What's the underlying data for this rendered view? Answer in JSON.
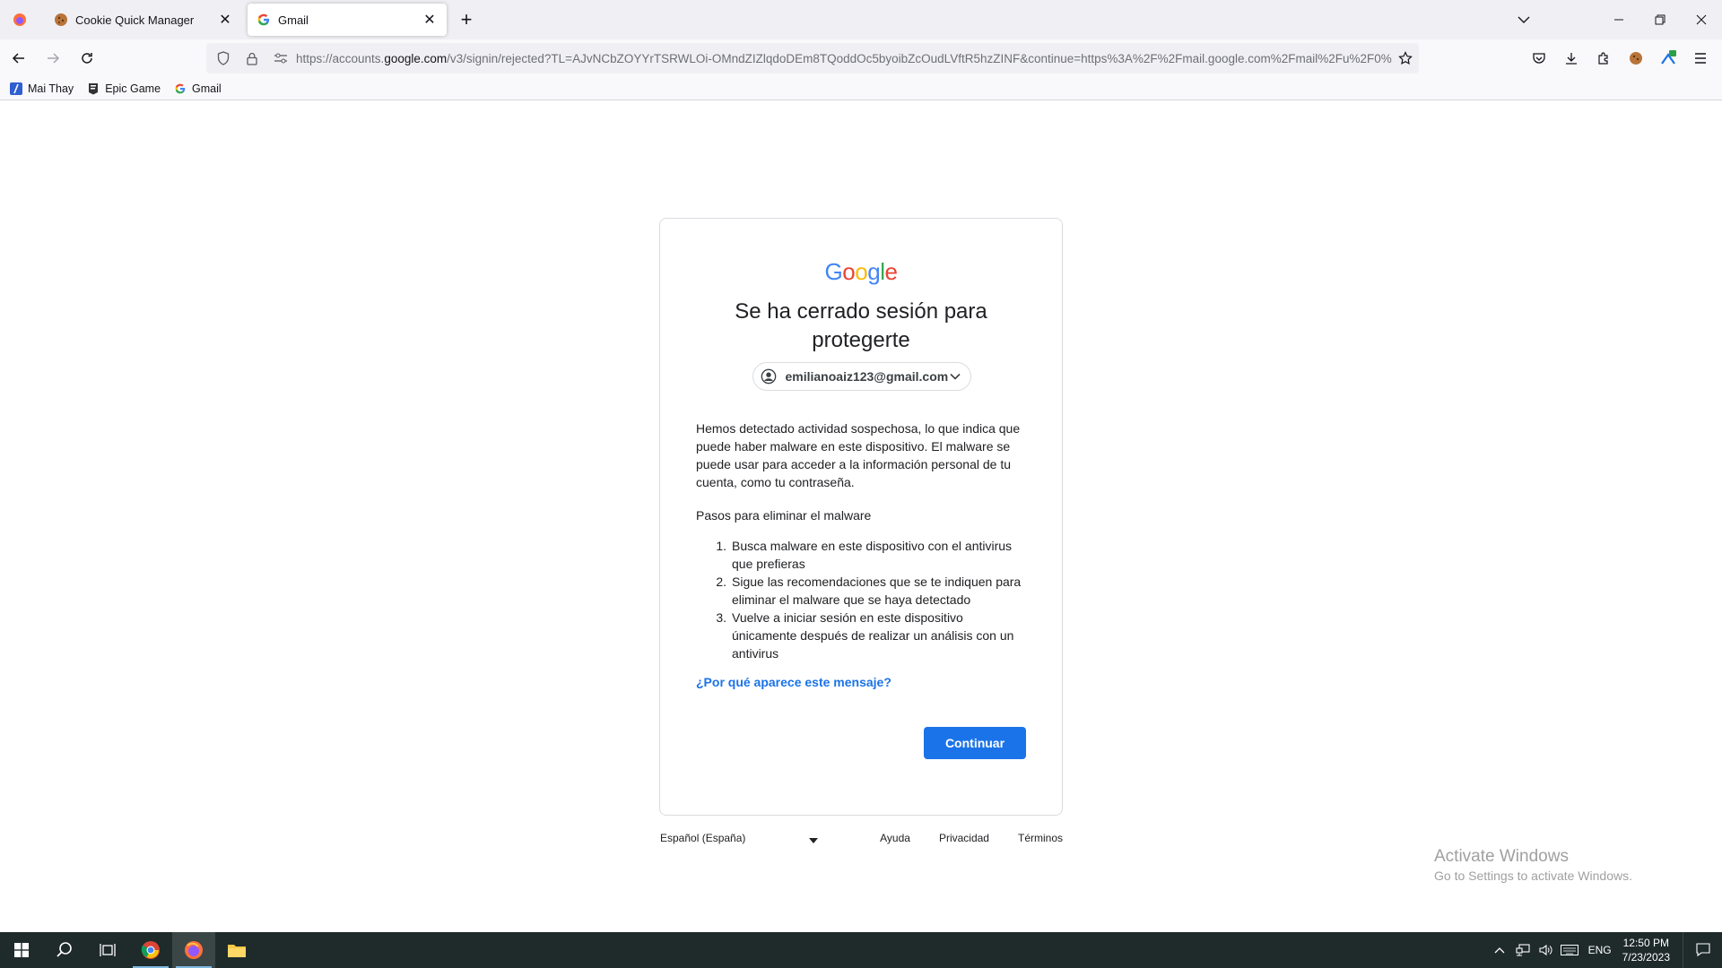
{
  "browser": {
    "tabs": [
      {
        "title": "Cookie Quick Manager",
        "favicon": "cookie-icon",
        "active": false
      },
      {
        "title": "Gmail",
        "favicon": "google-g-icon",
        "active": true
      }
    ],
    "url_prefix": "https://accounts.",
    "url_domain": "google.com",
    "url_rest": "/v3/signin/rejected?TL=AJvNCbZOYYrTSRWLOi-OMndZIZlqdoDEm8TQoddOc5byoibZcOudLVftR5hzZINF&continue=https%3A%2F%2Fmail.google.com%2Fmail%2Fu%2F0%",
    "bookmarks": [
      {
        "label": "Mai Thay",
        "icon": "bookmark-app-icon"
      },
      {
        "label": "Epic Game",
        "icon": "epic-games-icon"
      },
      {
        "label": "Gmail",
        "icon": "google-g-icon"
      }
    ]
  },
  "signin": {
    "logo_text": "Google",
    "headline": "Se ha cerrado sesión para protegerte",
    "account_email": "emilianoaiz123@gmail.com",
    "body": "Hemos detectado actividad sospechosa, lo que indica que puede haber malware en este dispositivo. El malware se puede usar para acceder a la información personal de tu cuenta, como tu contraseña.",
    "steps_title": "Pasos para eliminar el malware",
    "steps": [
      {
        "num": "1.",
        "text": "Busca malware en este dispositivo con el antivirus que prefieras"
      },
      {
        "num": "2.",
        "text": "Sigue las recomendaciones que se te indiquen para eliminar el malware que se haya detectado"
      },
      {
        "num": "3.",
        "text": "Vuelve a iniciar sesión en este dispositivo únicamente después de realizar un análisis con un antivirus"
      }
    ],
    "why_link": "¿Por qué aparece este mensaje?",
    "continue_label": "Continuar"
  },
  "footer": {
    "language": "Español (España)",
    "links": [
      "Ayuda",
      "Privacidad",
      "Términos"
    ]
  },
  "watermark": {
    "line1": "Activate Windows",
    "line2": "Go to Settings to activate Windows."
  },
  "taskbar": {
    "language": "ENG",
    "time": "12:50 PM",
    "date": "7/23/2023"
  },
  "colors": {
    "primary_button": "#1a73e8",
    "link": "#1a73e8",
    "taskbar": "#1e2b2a"
  }
}
